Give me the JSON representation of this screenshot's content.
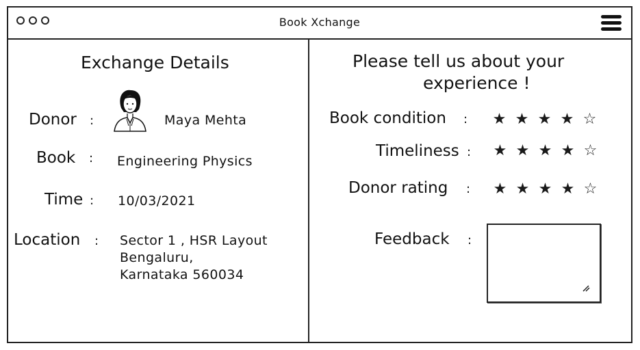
{
  "window": {
    "title": "Book Xchange",
    "menu_icon": "hamburger-icon"
  },
  "details": {
    "title": "Exchange Details",
    "donor_label": "Donor",
    "donor_name": "Maya Mehta",
    "book_label": "Book",
    "book_value": "Engineering Physics",
    "time_label": "Time",
    "time_value": "10/03/2021",
    "location_label": "Location",
    "location_lines": [
      "Sector 1 , HSR Layout",
      "Bengaluru,",
      "Karnataka 560034"
    ],
    "colon": ":"
  },
  "feedback": {
    "title_line1": "Please tell us about your",
    "title_line2": "experience !",
    "ratings": [
      {
        "label": "Book condition",
        "value": 4,
        "max": 5
      },
      {
        "label": "Timeliness",
        "value": 4,
        "max": 5
      },
      {
        "label": "Donor rating",
        "value": 4,
        "max": 5
      }
    ],
    "feedback_label": "Feedback",
    "feedback_value": "",
    "colon": ":"
  },
  "icons": {
    "star_filled": "★",
    "star_empty": "☆"
  }
}
